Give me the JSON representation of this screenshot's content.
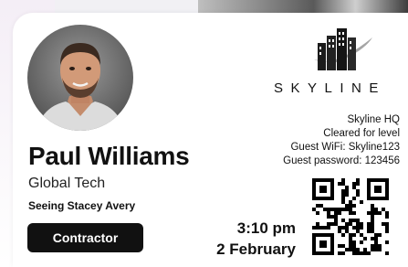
{
  "badge": {
    "name": "Paul Williams",
    "company": "Global Tech",
    "seeing": "Seeing Stacey Avery",
    "role_button": "Contractor",
    "brand": "SKYLINE",
    "info": {
      "location": "Skyline HQ",
      "clearance": "Cleared for level",
      "wifi": "Guest WiFi: Skyline123",
      "password": "Guest password: 123456"
    },
    "time": "3:10 pm",
    "date": "2 February"
  },
  "icons": {
    "logo": "skyline-buildings-logo-icon",
    "qr": "qr-code-icon",
    "photo": "visitor-photo"
  }
}
